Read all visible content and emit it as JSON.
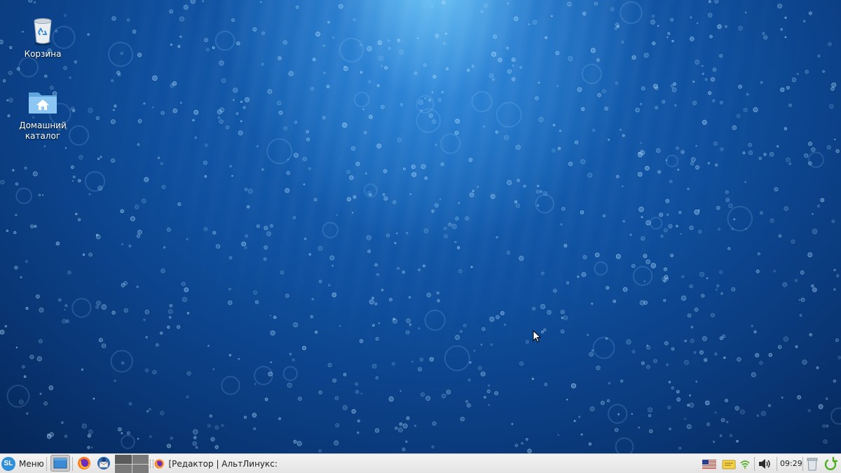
{
  "desktop": {
    "icons": [
      {
        "label": "Корзина",
        "icon": "trash-icon"
      },
      {
        "label": "Домашний каталог",
        "icon": "home-folder-icon"
      }
    ]
  },
  "panel": {
    "menu_label": "Меню",
    "menu_logo_text": "SL",
    "launchers": [
      {
        "icon": "show-desktop-icon",
        "active": true
      },
      {
        "icon": "firefox-icon"
      },
      {
        "icon": "thunderbird-icon"
      }
    ],
    "workspaces": {
      "count": 4,
      "current": 1
    },
    "task": {
      "icon": "firefox-icon",
      "title": "[Редактор | АльтЛинукс: ..."
    },
    "tray": [
      {
        "icon": "us-flag-icon"
      },
      {
        "icon": "clipboard-icon"
      },
      {
        "icon": "network-icon"
      },
      {
        "icon": "volume-icon"
      }
    ],
    "clock": "09:29",
    "trash_icon": "trash-applet-icon",
    "power_icon": "power-icon"
  },
  "colors": {
    "wallpaper_dark": "#06285a",
    "wallpaper_mid": "#0f4f9e",
    "wallpaper_light": "#78d2ff",
    "panel_bg": "#ececec",
    "accent_green": "#4caf1f"
  }
}
